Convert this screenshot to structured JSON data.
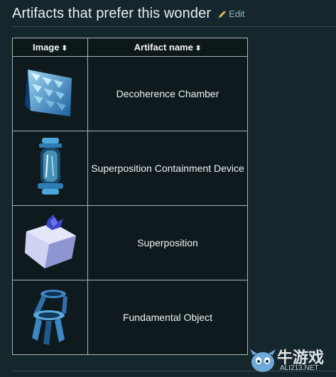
{
  "section": {
    "title": "Artifacts that prefer this wonder",
    "edit_label": "Edit"
  },
  "table": {
    "headers": [
      {
        "label": "Image",
        "sort_icon": "sort-icon"
      },
      {
        "label": "Artifact name",
        "sort_icon": "sort-icon"
      }
    ],
    "rows": [
      {
        "name": "Decoherence Chamber",
        "icon": "decoherence-chamber-icon"
      },
      {
        "name": "Superposition Containment Device",
        "icon": "superposition-containment-device-icon"
      },
      {
        "name": "Superposition",
        "icon": "superposition-icon"
      },
      {
        "name": "Fundamental Object",
        "icon": "fundamental-object-icon"
      }
    ]
  },
  "watermark": {
    "text": "牛游戏",
    "url": "ALI213.NET"
  },
  "colors": {
    "background": "#15272c",
    "link": "#8fb6c2",
    "border": "#a8b6b8"
  }
}
